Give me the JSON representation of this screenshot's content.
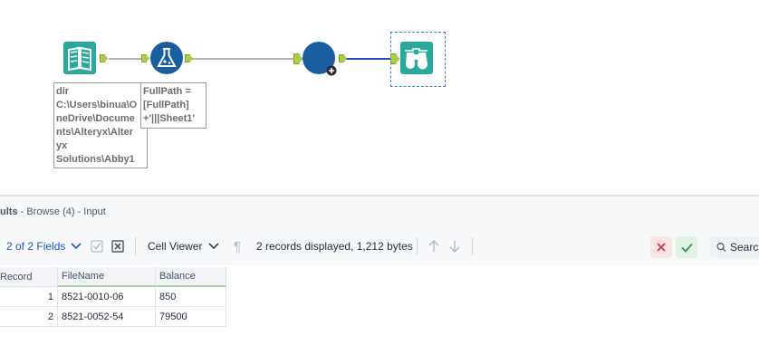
{
  "canvas": {
    "annotations": {
      "dir_tool": "dir\nC:\\Users\\binua\\O\nneDrive\\Docume\nnts\\Alteryx\\Alter\nyx\nSolutions\\Abby1",
      "formula_tool": "FullPath =\n[FullPath]\n+'|||Sheet1'"
    },
    "colors": {
      "directory_tool": "#2ba89c",
      "formula_tool": "#1b5ea0",
      "dynamic_input_tool": "#1b5ea0",
      "browse_tool": "#2ba89c",
      "wire": "#9a9a9a",
      "selected_wire": "#2d46c9"
    }
  },
  "results": {
    "title_prefix": "ults",
    "title_rest": " - Browse (4) - Input"
  },
  "toolbar": {
    "fields_label": "2 of 2 Fields",
    "cell_viewer_label": "Cell Viewer",
    "status_text": "2 records displayed, 1,212 bytes",
    "search_placeholder": "Search"
  },
  "grid": {
    "columns": [
      "Record",
      "FileName",
      "Balance"
    ],
    "rows": [
      {
        "record": "1",
        "filename": "8521-0010-06",
        "balance": "850"
      },
      {
        "record": "2",
        "filename": "8521-0052-54",
        "balance": "79500"
      }
    ]
  }
}
